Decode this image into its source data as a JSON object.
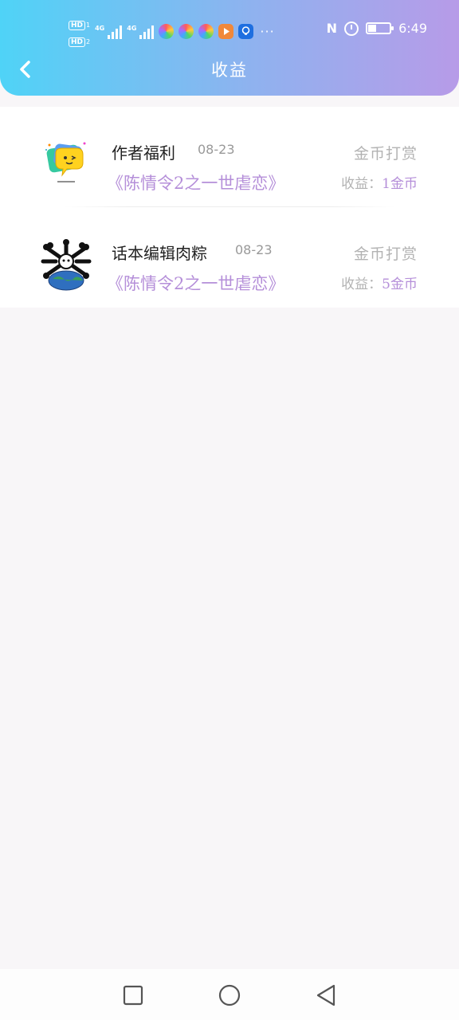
{
  "status_bar": {
    "hd1": "HD",
    "hd1_sub": "1",
    "hd2": "HD",
    "hd2_sub": "2",
    "signal1_label": "4G",
    "signal2_label": "4G",
    "more_indicator": "···",
    "nfc_label": "N",
    "time": "6:49",
    "battery_level": 0.4,
    "app_icons": [
      "colorful-ring-app-icon",
      "colorful-ring-app-icon",
      "colorful-ring-app-icon",
      "orange-video-app-icon",
      "blue-bulb-app-icon"
    ]
  },
  "header": {
    "title": "收益",
    "back_icon": "chevron-left-icon",
    "gradient": [
      "#4fd3f7",
      "#8fb2ef",
      "#b79be8"
    ]
  },
  "records": [
    {
      "avatar": "yellow-chat-bubble-avatar",
      "name": "作者福利",
      "date": "08-23",
      "book": "《陈情令2之一世虐恋》",
      "type": "金币打赏",
      "earn_label": "收益：",
      "earn_value": "1金币"
    },
    {
      "avatar": "globe-crossbones-avatar",
      "name": "话本编辑肉粽",
      "date": "08-23",
      "book": "《陈情令2之一世虐恋》",
      "type": "金币打赏",
      "earn_label": "收益：",
      "earn_value": "5金币"
    }
  ],
  "colors": {
    "accent_purple": "#b58fd9",
    "muted_gray": "#b3b3b3",
    "page_bg": "#f8f6f8"
  },
  "nav_bar": {
    "icons": [
      "square-recents-icon",
      "circle-home-icon",
      "triangle-back-icon"
    ]
  }
}
